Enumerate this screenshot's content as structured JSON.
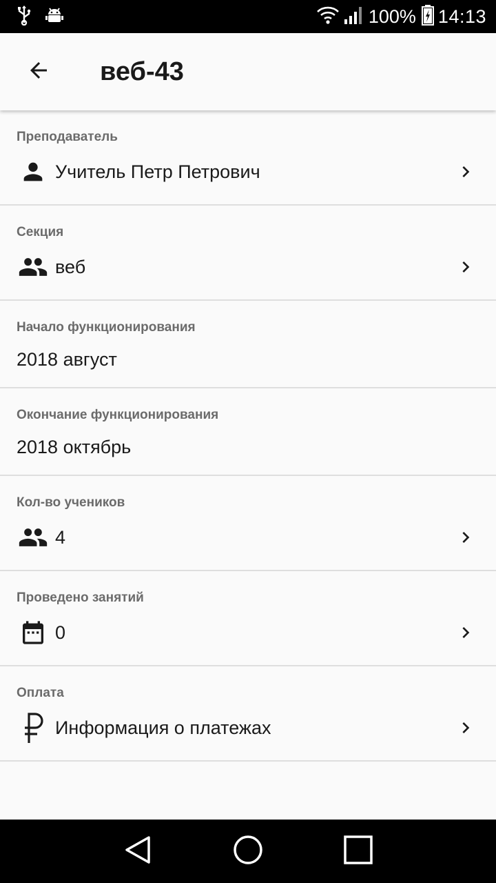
{
  "status_bar": {
    "battery_percent": "100%",
    "time": "14:13",
    "left_icons": [
      "usb-icon",
      "android-debug-icon"
    ],
    "right_icons": [
      "wifi-icon",
      "cellular-signal-icon",
      "battery-charging-icon"
    ]
  },
  "app_bar": {
    "title": "веб-43",
    "back_icon": "arrow-back-icon"
  },
  "sections": {
    "teacher": {
      "label": "Преподаватель",
      "value": "Учитель Петр Петрович",
      "icon": "person-icon"
    },
    "section": {
      "label": "Секция",
      "value": "веб",
      "icon": "group-icon"
    },
    "start": {
      "label": "Начало функционирования",
      "value": "2018 август"
    },
    "end": {
      "label": "Окончание функционирования",
      "value": "2018 октябрь"
    },
    "students": {
      "label": "Кол-во учеников",
      "value": "4",
      "icon": "group-icon"
    },
    "lessons": {
      "label": "Проведено занятий",
      "value": "0",
      "icon": "calendar-icon"
    },
    "payment": {
      "label": "Оплата",
      "value": "Информация о платежах",
      "icon": "ruble-icon"
    }
  },
  "nav_bar": {
    "buttons": [
      "back-triangle-icon",
      "home-circle-icon",
      "recents-square-icon"
    ]
  }
}
